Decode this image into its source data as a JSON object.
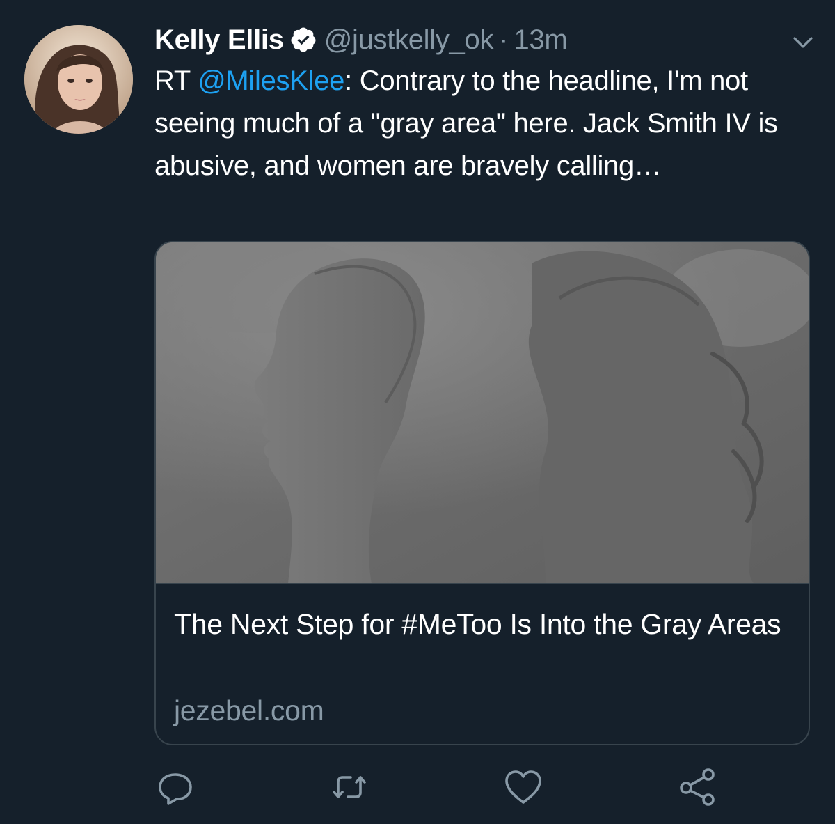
{
  "tweet": {
    "author_name": "Kelly Ellis",
    "handle": "@justkelly_ok",
    "separator": "·",
    "timestamp": "13m",
    "verified": true,
    "text_prefix": "RT ",
    "mention": "@MilesKlee",
    "text_rest": ": Contrary to the headline, I'm not seeing much of a \"gray area\" here. Jack Smith IV is abusive, and women are bravely calling…"
  },
  "card": {
    "title": "The Next Step for #MeToo Is Into the Gray Areas",
    "domain": "jezebel.com"
  },
  "icons": {
    "verified": "verified-badge-icon",
    "caret": "chevron-down-icon",
    "reply": "reply-icon",
    "retweet": "retweet-icon",
    "like": "heart-icon",
    "share": "share-icon"
  },
  "colors": {
    "background": "#15202b",
    "text": "#ffffff",
    "secondary": "#8899a6",
    "link": "#1da1f2",
    "border": "#38444d"
  }
}
